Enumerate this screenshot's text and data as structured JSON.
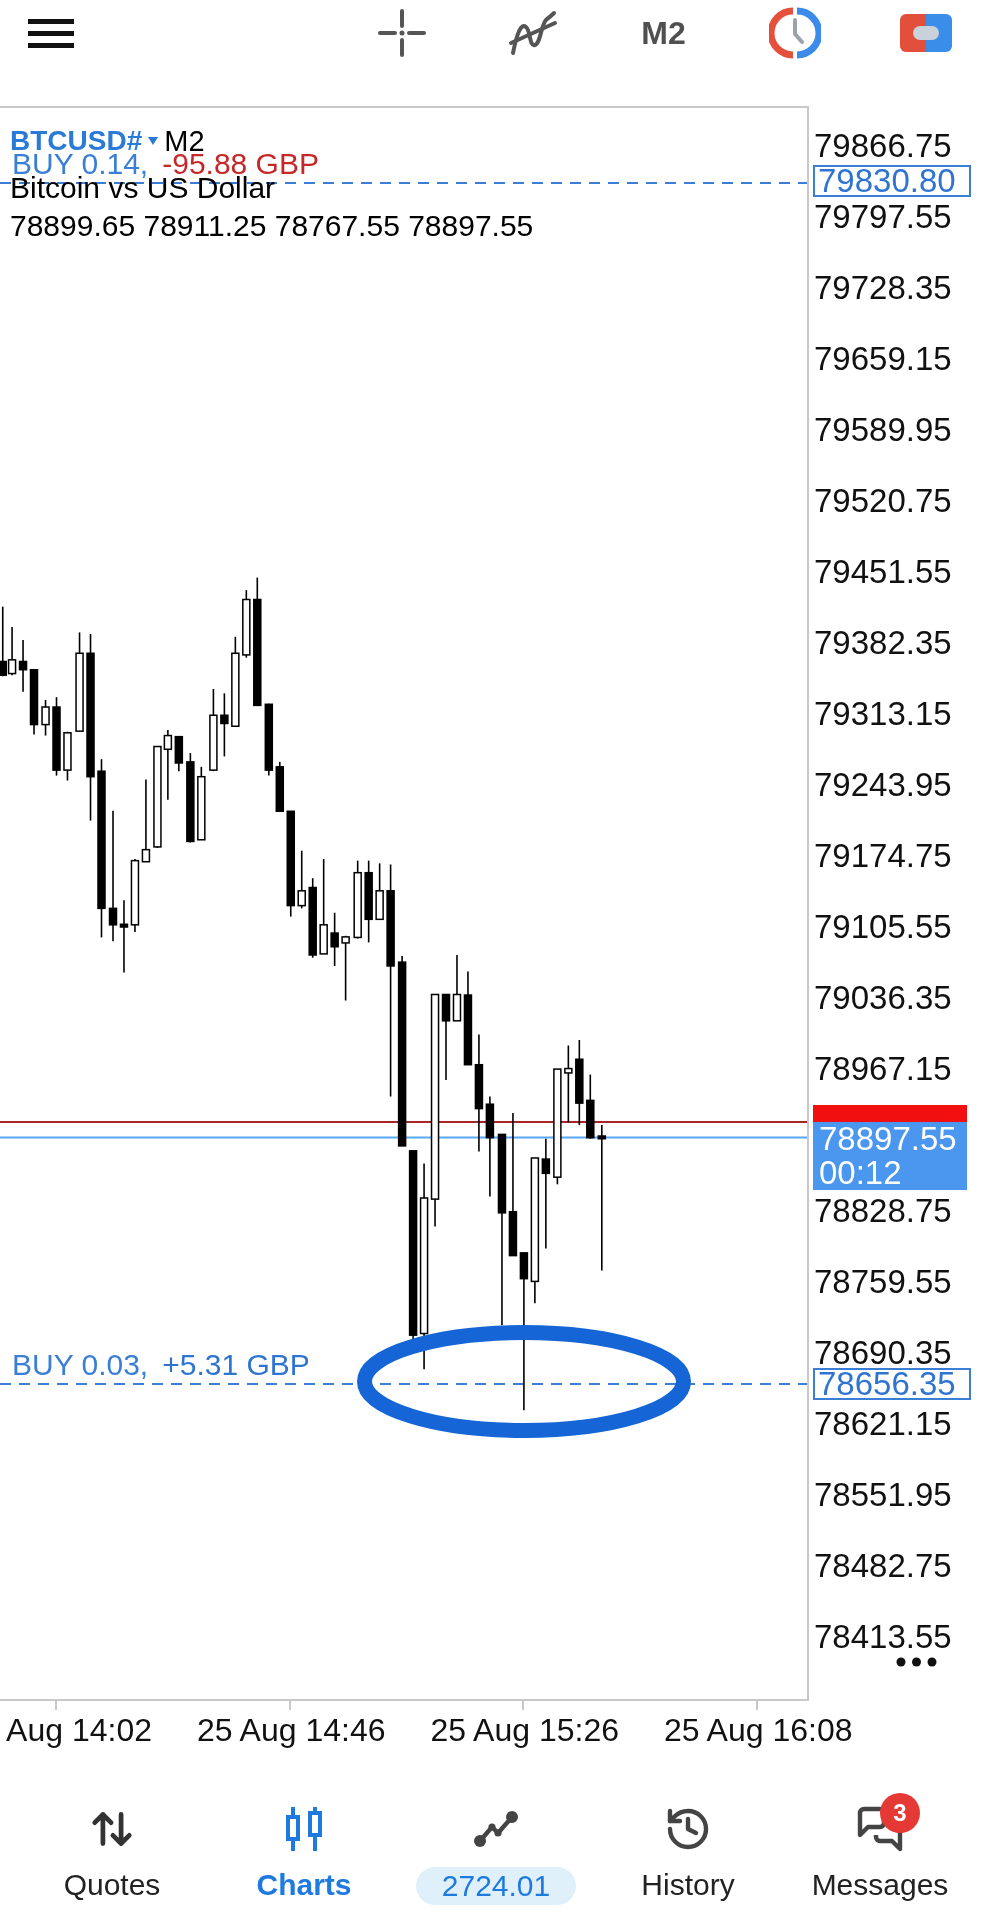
{
  "toolbar": {
    "timeframe": "M2"
  },
  "chart": {
    "symbol": "BTCUSD#",
    "timeframe": "M2",
    "description": "Bitcoin vs US Dollar",
    "ohlc": "78899.65 78911.25 78767.55 78897.55",
    "order_lines": [
      {
        "label": "BUY 0.14,",
        "profit": "-95.88 GBP",
        "color": "#c62828",
        "price": "79830.80"
      },
      {
        "label": "BUY 0.03,",
        "profit": "+5.31 GBP",
        "color": "#2f74d0",
        "price": "78656.35"
      }
    ],
    "bid_price": "78897.55",
    "bar_countdown": "00:12",
    "price_axis": {
      "labels_above_price": [
        "79866.75",
        "79797.55",
        "79728.35",
        "79659.15",
        "79589.95",
        "79520.75",
        "79451.55",
        "79382.35",
        "79313.15",
        "79243.95",
        "79174.75",
        "79105.55",
        "79036.35",
        "78967.15"
      ],
      "labels_below_price": [
        "78828.75",
        "78759.55",
        "78690.35",
        "78621.15",
        "78551.95",
        "78482.75",
        "78413.55"
      ]
    },
    "time_axis": {
      "labels": [
        "Aug 14:02",
        "25 Aug 14:46",
        "25 Aug 15:26",
        "25 Aug 16:08"
      ]
    }
  },
  "nav": [
    {
      "kind": "tab",
      "label": "Quotes",
      "selected": false
    },
    {
      "kind": "tab",
      "label": "Charts",
      "selected": true
    },
    {
      "kind": "pill",
      "label": "2724.01",
      "selected": false
    },
    {
      "kind": "tab",
      "label": "History",
      "selected": false
    },
    {
      "kind": "tab",
      "label": "Messages",
      "selected": false,
      "badge": "3"
    }
  ]
}
